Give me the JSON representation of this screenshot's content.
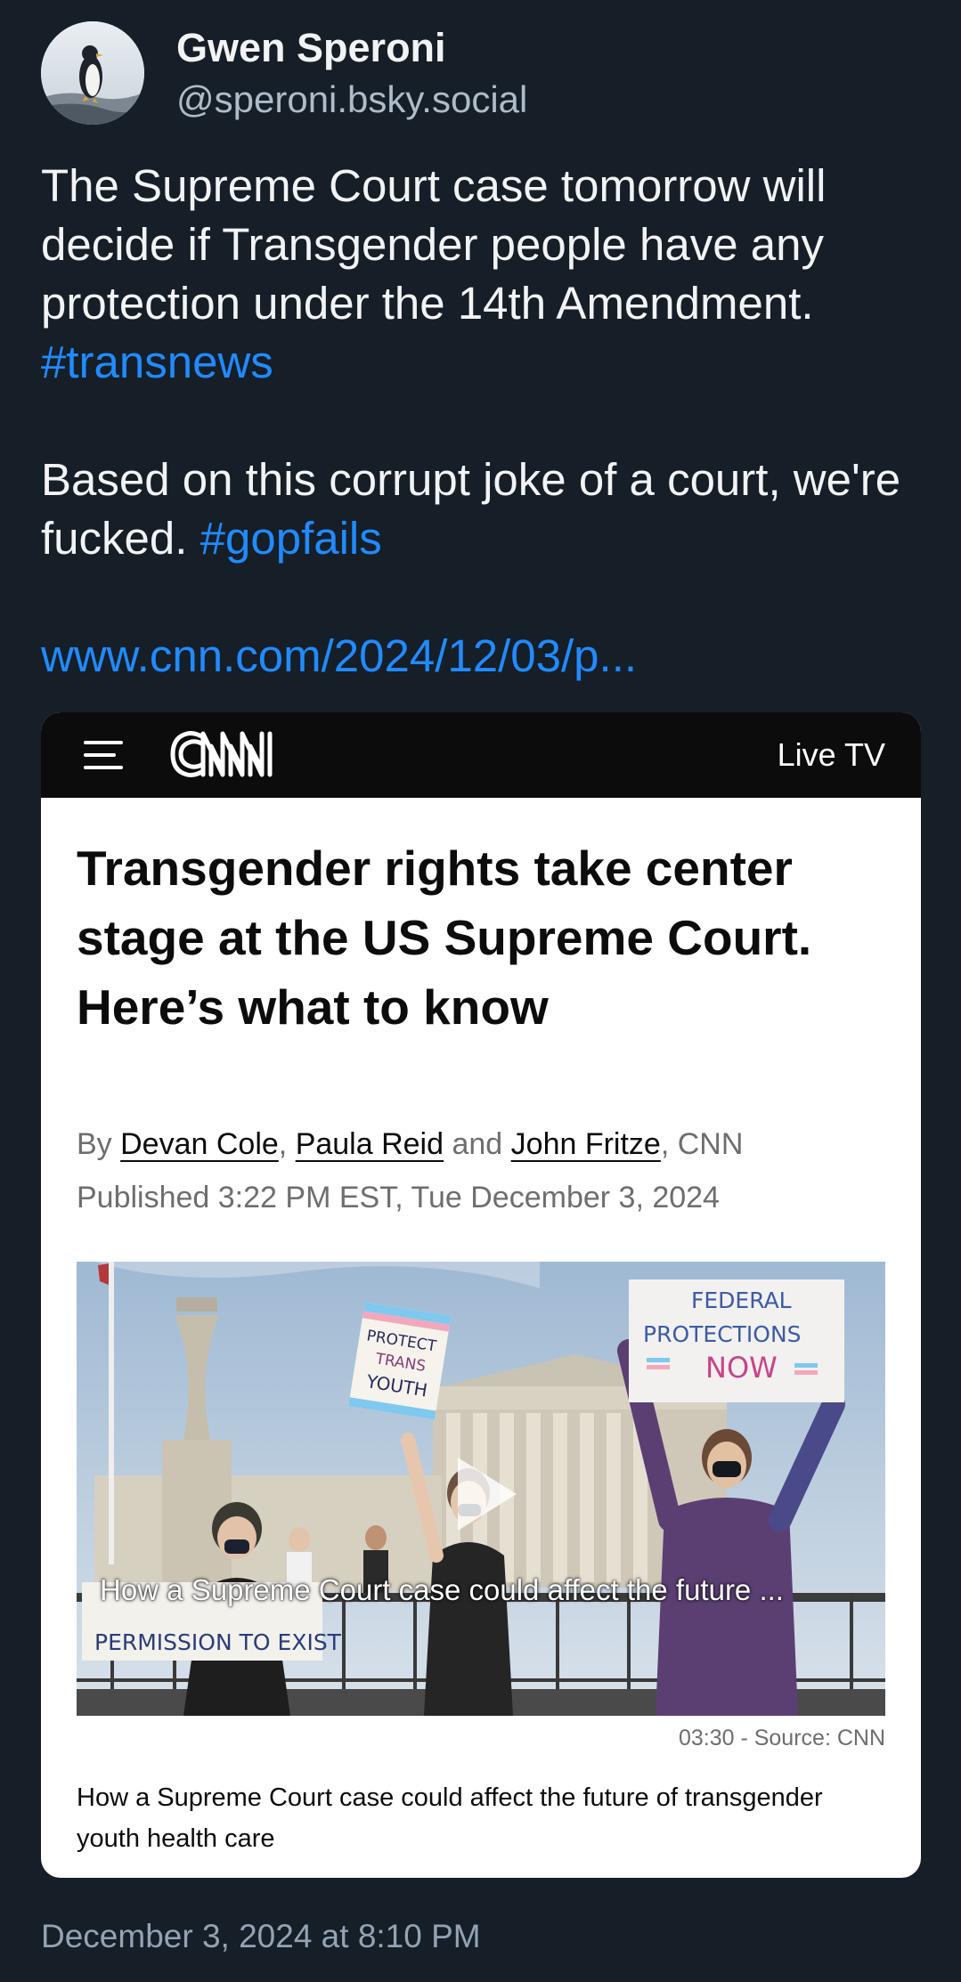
{
  "author": {
    "display_name": "Gwen Speroni",
    "handle": "@speroni.bsky.social",
    "avatar_icon": "penguin-avatar"
  },
  "post": {
    "text_part1": "The Supreme Court case tomorrow will decide if Transgender people have any protection under the 14th Amendment. ",
    "hashtag1": "#transnews",
    "text_part2": "Based on this corrupt joke of a court, we're fucked. ",
    "hashtag2": "#gopfails",
    "link": "www.cnn.com/2024/12/03/p...",
    "timestamp": "December 3, 2024 at 8:10 PM"
  },
  "embed": {
    "site_logo": "CNN",
    "live_tv_label": "Live TV",
    "headline": "Transgender rights take center stage at the US Supreme Court. Here’s what to know",
    "by_prefix": "By ",
    "authors": [
      "Devan Cole",
      "Paula Reid",
      "John Fritze"
    ],
    "sep1": ", ",
    "and": " and ",
    "outlet_suffix": ", CNN",
    "published": "Published 3:22 PM EST, Tue December 3, 2024",
    "video_overlay_caption": "How a Supreme Court case could affect the future ...",
    "video_duration_source": "03:30 - Source: CNN",
    "video_caption": "How a Supreme Court case could affect the future of transgender youth health care",
    "signs": {
      "protect": [
        "PROTECT",
        "TRANS",
        "YOUTH"
      ],
      "federal": [
        "FEDERAL",
        "PROTECTIONS",
        "NOW"
      ],
      "permission": "PERMISSION TO EXIST"
    }
  },
  "colors": {
    "background": "#161e27",
    "hashtag_link": "#208bfe",
    "cnn_bar": "#0c0c0c"
  }
}
